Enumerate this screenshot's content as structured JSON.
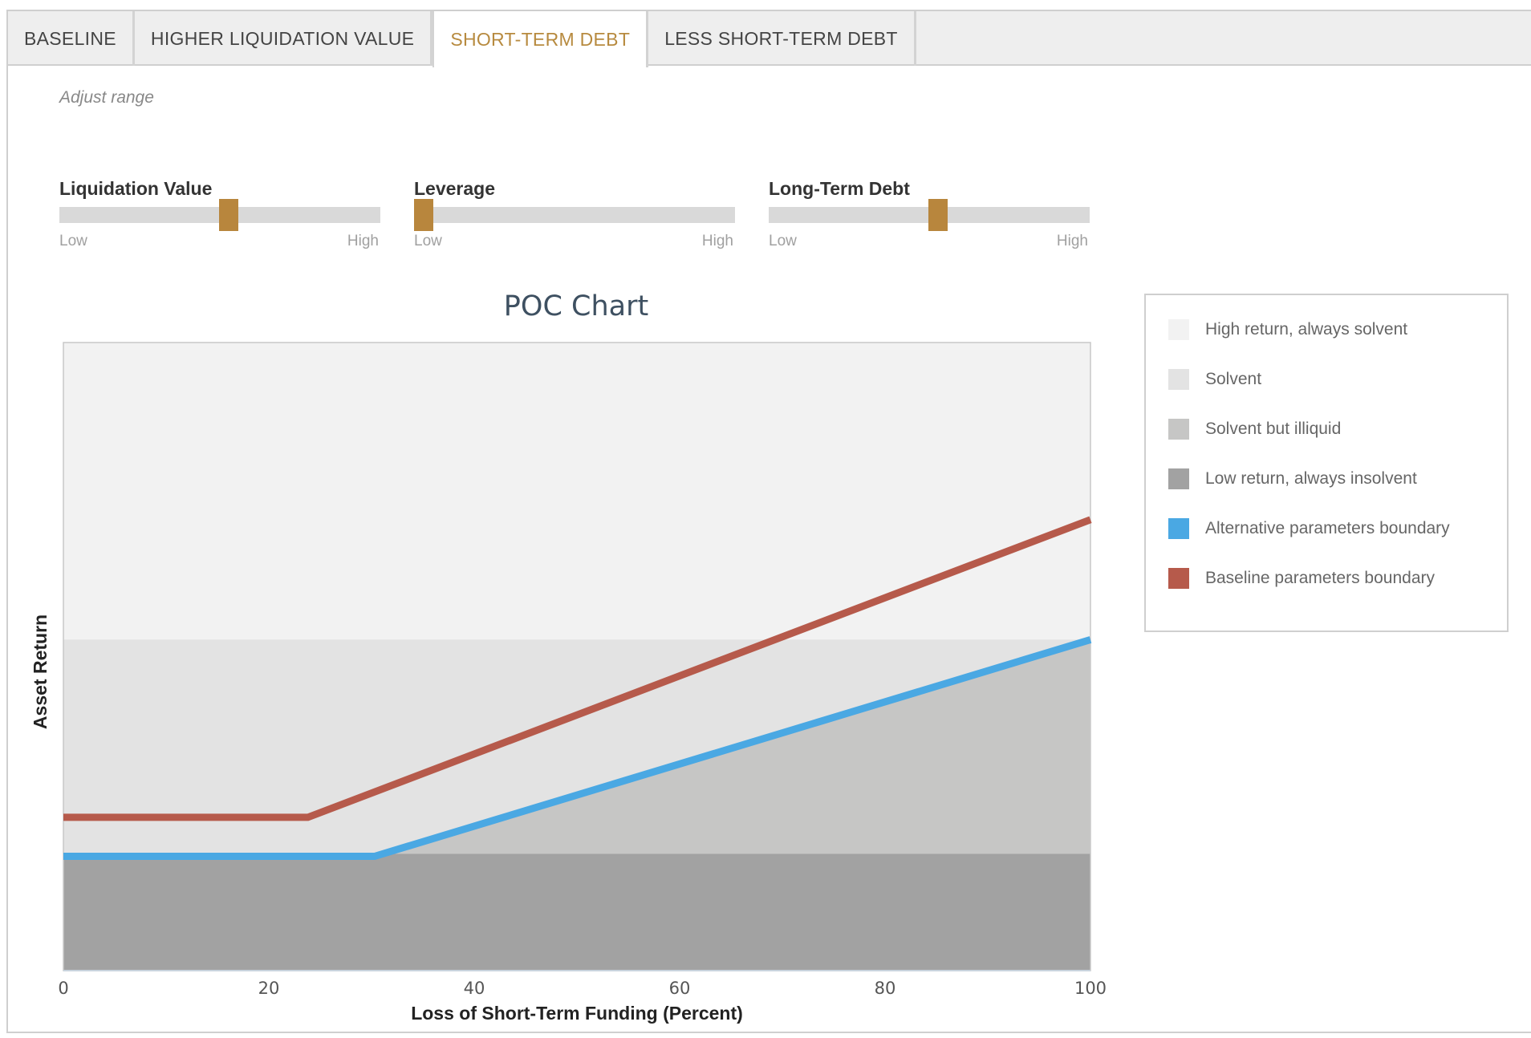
{
  "tabs": [
    {
      "label": "BASELINE",
      "active": false
    },
    {
      "label": "HIGHER LIQUIDATION VALUE",
      "active": false
    },
    {
      "label": "SHORT-TERM DEBT",
      "active": true
    },
    {
      "label": "LESS SHORT-TERM DEBT",
      "active": false
    }
  ],
  "controls": {
    "adjust_range_label": "Adjust range",
    "sliders": [
      {
        "name": "Liquidation Value",
        "low_label": "Low",
        "high_label": "High",
        "value_fraction": 0.53
      },
      {
        "name": "Leverage",
        "low_label": "Low",
        "high_label": "High",
        "value_fraction": 0.0
      },
      {
        "name": "Long-Term Debt",
        "low_label": "Low",
        "high_label": "High",
        "value_fraction": 0.53
      }
    ]
  },
  "colors": {
    "accent": "#b78a3f",
    "slider_thumb": "#b8863d",
    "high_return_always_solvent": "#f2f2f2",
    "solvent": "#e3e3e3",
    "solvent_but_illiquid": "#c6c6c5",
    "low_return_always_insolvent": "#a2a2a2",
    "alternative_boundary": "#4aa8e3",
    "baseline_boundary": "#b65a4b"
  },
  "chart_data": {
    "type": "area",
    "title": "POC Chart",
    "xlabel": "Loss of Short-Term Funding (Percent)",
    "ylabel": "Asset Return",
    "xlim": [
      0,
      100
    ],
    "ylim": [
      0,
      1
    ],
    "x_ticks": [
      0,
      20,
      40,
      60,
      80,
      100
    ],
    "y_tick_labels_shown": false,
    "grid": false,
    "legend_position": "right",
    "regions": [
      {
        "name": "High return, always solvent",
        "y_from": 0.527,
        "y_to": 1.0,
        "color": "#f2f2f2"
      },
      {
        "name": "Solvent",
        "boundary": "alternative",
        "color": "#e3e3e3"
      },
      {
        "name": "Solvent but illiquid",
        "y_from": 0.186,
        "boundary": "alternative",
        "color": "#c6c6c5"
      },
      {
        "name": "Low return, always insolvent",
        "y_from": 0.0,
        "y_to": 0.186,
        "color": "#a2a2a2"
      }
    ],
    "series": [
      {
        "name": "Alternative parameters boundary",
        "x": [
          0,
          30.3,
          100
        ],
        "y": [
          0.182,
          0.182,
          0.527
        ],
        "color": "#4aa8e3"
      },
      {
        "name": "Baseline parameters boundary",
        "x": [
          0,
          23.8,
          100
        ],
        "y": [
          0.244,
          0.244,
          0.718
        ],
        "color": "#b65a4b"
      }
    ],
    "legend": [
      {
        "label": "High return, always solvent",
        "color": "#f2f2f2"
      },
      {
        "label": "Solvent",
        "color": "#e3e3e3"
      },
      {
        "label": "Solvent but illiquid",
        "color": "#c6c6c5"
      },
      {
        "label": "Low return, always insolvent",
        "color": "#a2a2a2"
      },
      {
        "label": "Alternative parameters boundary",
        "color": "#4aa8e3"
      },
      {
        "label": "Baseline parameters boundary",
        "color": "#b65a4b"
      }
    ]
  }
}
